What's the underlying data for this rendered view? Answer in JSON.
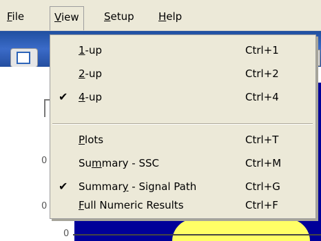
{
  "menubar": {
    "items": [
      {
        "pre": "",
        "key": "F",
        "post": "ile"
      },
      {
        "pre": "",
        "key": "V",
        "post": "iew"
      },
      {
        "pre": "",
        "key": "S",
        "post": "etup"
      },
      {
        "pre": "",
        "key": "H",
        "post": "elp"
      }
    ]
  },
  "view_menu": {
    "items": [
      {
        "pre": "",
        "key": "1",
        "post": "-up",
        "shortcut": "Ctrl+1",
        "checked": false
      },
      {
        "pre": "",
        "key": "2",
        "post": "-up",
        "shortcut": "Ctrl+2",
        "checked": false
      },
      {
        "pre": "",
        "key": "4",
        "post": "-up",
        "shortcut": "Ctrl+4",
        "checked": true
      },
      {
        "pre": "",
        "key": "P",
        "post": "lots",
        "shortcut": "Ctrl+T",
        "checked": false
      },
      {
        "pre": "Su",
        "key": "m",
        "post": "mary - SSC",
        "shortcut": "Ctrl+M",
        "checked": false
      },
      {
        "pre": "Summar",
        "key": "y",
        "post": " - Signal Path",
        "shortcut": "Ctrl+G",
        "checked": true
      },
      {
        "pre": "",
        "key": "F",
        "post": "ull Numeric Results",
        "shortcut": "Ctrl+F",
        "checked": false
      }
    ],
    "check_glyph": "✔"
  },
  "background": {
    "axis_zero": "0",
    "ylabels": [
      "0",
      "0"
    ]
  },
  "colors": {
    "menu_bg": "#ece9d8",
    "toolbar_blue": "#3b6bc8",
    "plot_blue": "#000099",
    "plot_yellow": "#ffff66"
  }
}
